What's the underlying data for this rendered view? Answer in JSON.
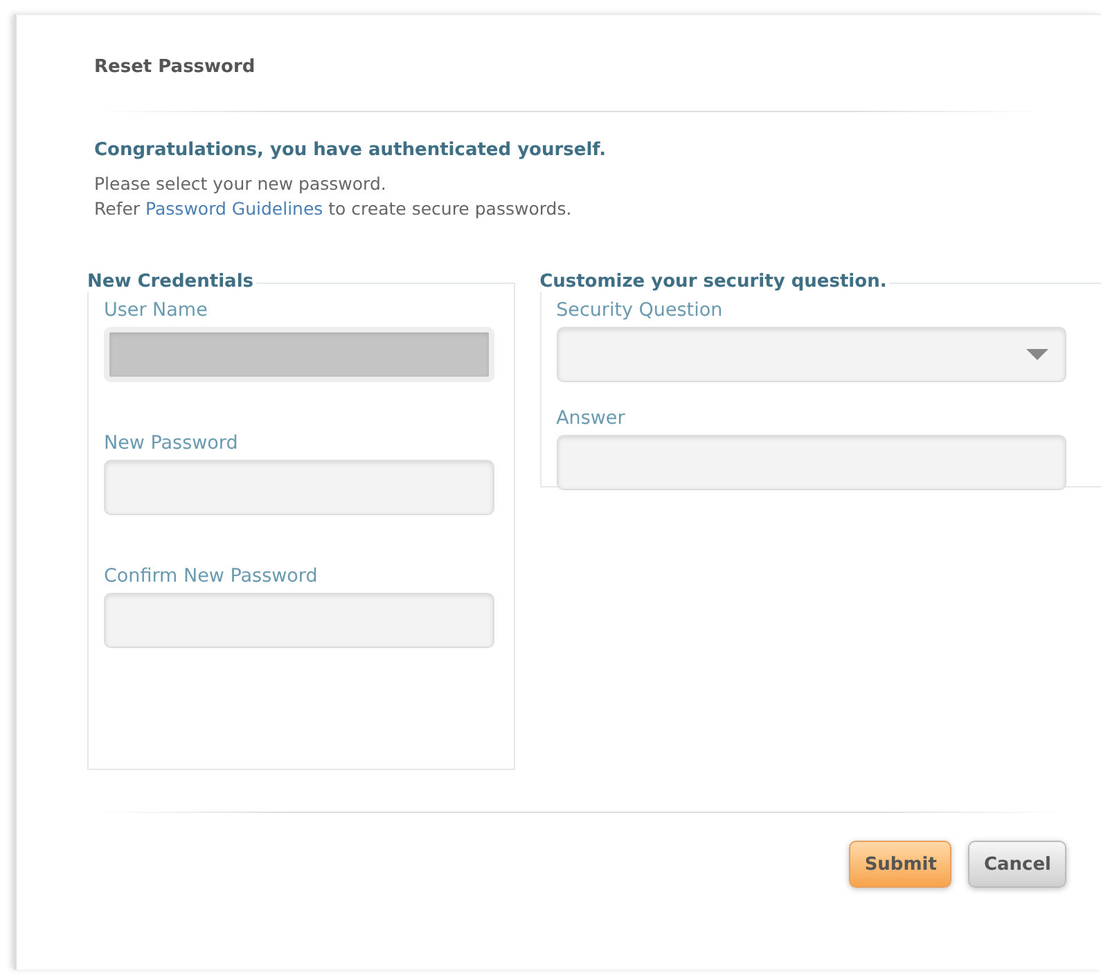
{
  "title": "Reset Password",
  "message": {
    "heading": "Congratulations, you have authenticated yourself.",
    "line_1": "Please select your new password.",
    "line_2_before": "Refer",
    "link": "Password Guidelines",
    "line_2_after": "to create secure passwords."
  },
  "panels": [
    {
      "legend": "New Credentials",
      "fields": [
        {
          "label": "User Name",
          "kind": "text",
          "disabled": true
        },
        {
          "label": "New Password",
          "kind": "text",
          "disabled": false
        },
        {
          "label": "Confirm New Password",
          "kind": "text",
          "disabled": false
        }
      ]
    },
    {
      "legend": "Customize your security question.",
      "fields": [
        {
          "label": "Security Question",
          "kind": "select",
          "disabled": false
        },
        {
          "label": "Answer",
          "kind": "text",
          "disabled": false
        }
      ]
    }
  ],
  "buttons": [
    {
      "label": "Submit",
      "kind": "primary"
    },
    {
      "label": "Cancel",
      "kind": "secondary"
    }
  ]
}
